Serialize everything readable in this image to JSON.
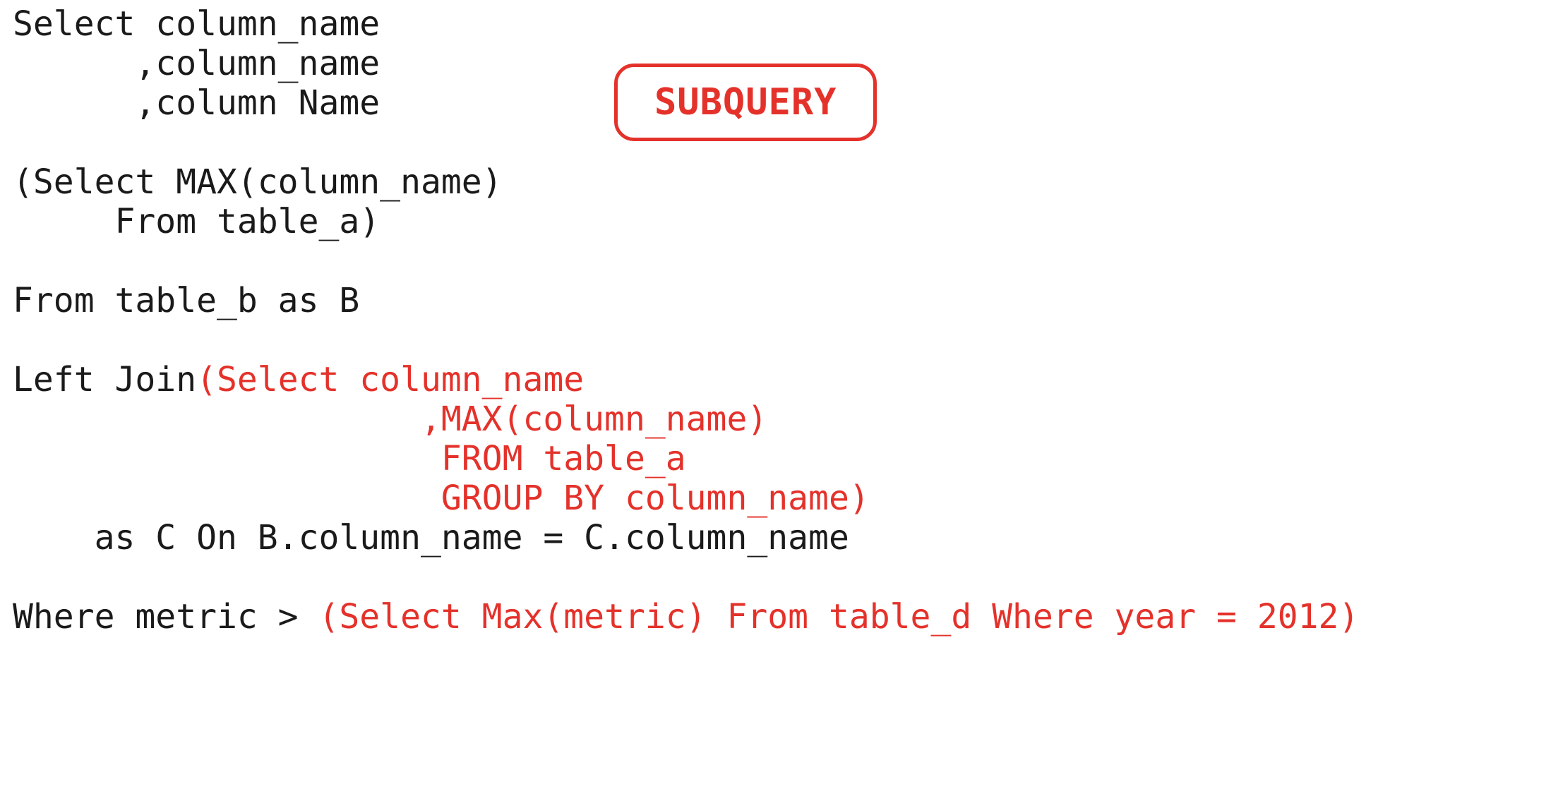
{
  "badge": {
    "label": "SUBQUERY"
  },
  "code": {
    "l01": "Select column_name",
    "l02": "      ,column_name",
    "l03": "      ,column Name",
    "l04": "",
    "l05": "(Select MAX(column_name)",
    "l06": "     From table_a)",
    "l07": "",
    "l08": "From table_b as B",
    "l09": "",
    "l10a": "Left Join",
    "l10b": "(Select column_name",
    "l11": "                    ,MAX(column_name)",
    "l12": "                     FROM table_a",
    "l13": "                     GROUP BY column_name)",
    "l14": "    as C On B.column_name = C.column_name",
    "l15": "",
    "l16a": "Where metric > ",
    "l16b": "(Select Max(metric) From table_d Where year = 2012)"
  },
  "colors": {
    "text": "#1a1a1a",
    "accent": "#e4322b",
    "bg": "#ffffff"
  }
}
